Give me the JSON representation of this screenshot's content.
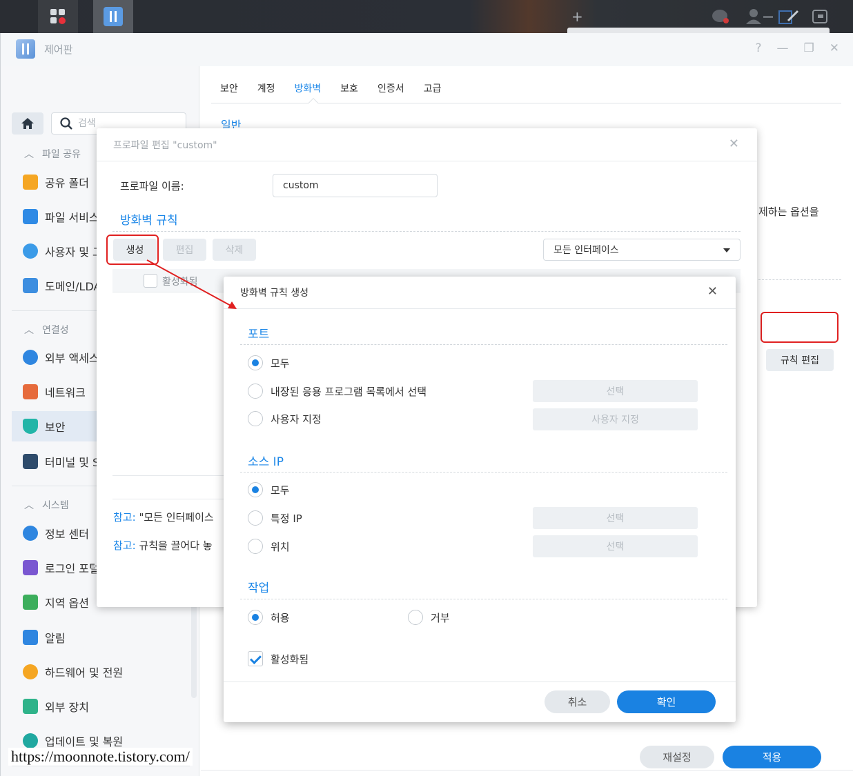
{
  "window": {
    "title": "제어판",
    "controls": [
      "?",
      "—",
      "❐",
      "✕"
    ]
  },
  "search": {
    "placeholder": "검색"
  },
  "sidebar": {
    "sections": [
      {
        "label": "파일 공유"
      },
      {
        "label": "연결성"
      },
      {
        "label": "시스템"
      }
    ],
    "items": [
      {
        "label": "공유 폴더",
        "color": "#f5a623"
      },
      {
        "label": "파일 서비스",
        "color": "#2f8ae5"
      },
      {
        "label": "사용자 및 그룹",
        "color": "#3b9be8"
      },
      {
        "label": "도메인/LDAP",
        "color": "#3d8ee0"
      },
      {
        "label": "외부 액세스",
        "color": "#2f86e0"
      },
      {
        "label": "네트워크",
        "color": "#e66b3c"
      },
      {
        "label": "보안",
        "color": "#22b5a8"
      },
      {
        "label": "터미널 및 SNMP",
        "color": "#2e4b6b"
      },
      {
        "label": "정보 센터",
        "color": "#2f86e0"
      },
      {
        "label": "로그인 포털",
        "color": "#7a57d1"
      },
      {
        "label": "지역 옵션",
        "color": "#3cae5c"
      },
      {
        "label": "알림",
        "color": "#2f86e0"
      },
      {
        "label": "하드웨어 및 전원",
        "color": "#f5a623"
      },
      {
        "label": "외부 장치",
        "color": "#2fb38a"
      },
      {
        "label": "업데이트 및 복원",
        "color": "#20a8a0"
      }
    ]
  },
  "tabs": [
    "보안",
    "계정",
    "방화벽",
    "보호",
    "인증서",
    "고급"
  ],
  "active_tab": "방화벽",
  "content": {
    "section_title": "일반",
    "desc_fragment": "제하는 옵션을",
    "rule_edit_button": "규칙 편집"
  },
  "footer": {
    "reset": "재설정",
    "apply": "적용"
  },
  "profile_dialog": {
    "title": "프로파일 편집 \"custom\"",
    "name_label": "프로파일 이름:",
    "name_value": "custom",
    "rules_title": "방화벽 규칙",
    "buttons": {
      "create": "생성",
      "edit": "편집",
      "delete": "삭제"
    },
    "interface_select": "모든 인터페이스",
    "table_header_enabled": "활성화됨",
    "note1_prefix": "참고:",
    "note1_text": "\"모든 인터페이스",
    "note2_prefix": "참고:",
    "note2_text": "규칙을 끌어다 놓"
  },
  "rule_dialog": {
    "title": "방화벽 규칙 생성",
    "port": {
      "title": "포트",
      "options": [
        "모두",
        "내장된 응용 프로그램 목록에서 선택",
        "사용자 지정"
      ],
      "buttons": [
        "선택",
        "사용자 지정"
      ]
    },
    "source_ip": {
      "title": "소스 IP",
      "options": [
        "모두",
        "특정 IP",
        "위치"
      ],
      "buttons": [
        "선택",
        "선택"
      ]
    },
    "action": {
      "title": "작업",
      "options": [
        "허용",
        "거부"
      ]
    },
    "enabled_label": "활성화됨",
    "cancel": "취소",
    "ok": "확인"
  },
  "watermark": "https://moonnote.tistory.com/",
  "colors": {
    "accent": "#1a82e2",
    "highlight": "#e02020"
  }
}
